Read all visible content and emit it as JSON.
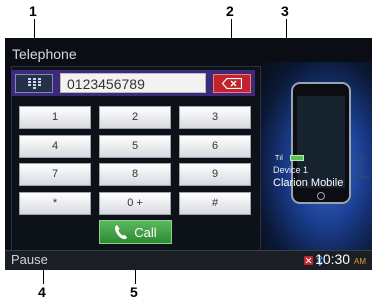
{
  "callouts": {
    "c1": "1",
    "c2": "2",
    "c3": "3",
    "c4": "4",
    "c5": "5"
  },
  "screen": {
    "title": "Telephone",
    "dial_number": "0123456789",
    "keypad": [
      "1",
      "2",
      "3",
      "4",
      "5",
      "6",
      "7",
      "8",
      "9",
      "*",
      "0 +",
      "#"
    ],
    "call_label": "Call",
    "status": {
      "left": "Pause",
      "time": "10:30",
      "ampm": "AM"
    },
    "device": {
      "signal": "Tıl",
      "label": "Device 1",
      "name": "Clarion Mobile",
      "index": "1"
    }
  },
  "colors": {
    "delete": "#c0242c",
    "call": "#2d8a33",
    "accent": "#3d2a7a"
  },
  "icons": [
    "keypad-icon",
    "backspace-icon",
    "phone-handset-icon",
    "bluetooth-icon",
    "battery-icon",
    "signal-icon"
  ]
}
